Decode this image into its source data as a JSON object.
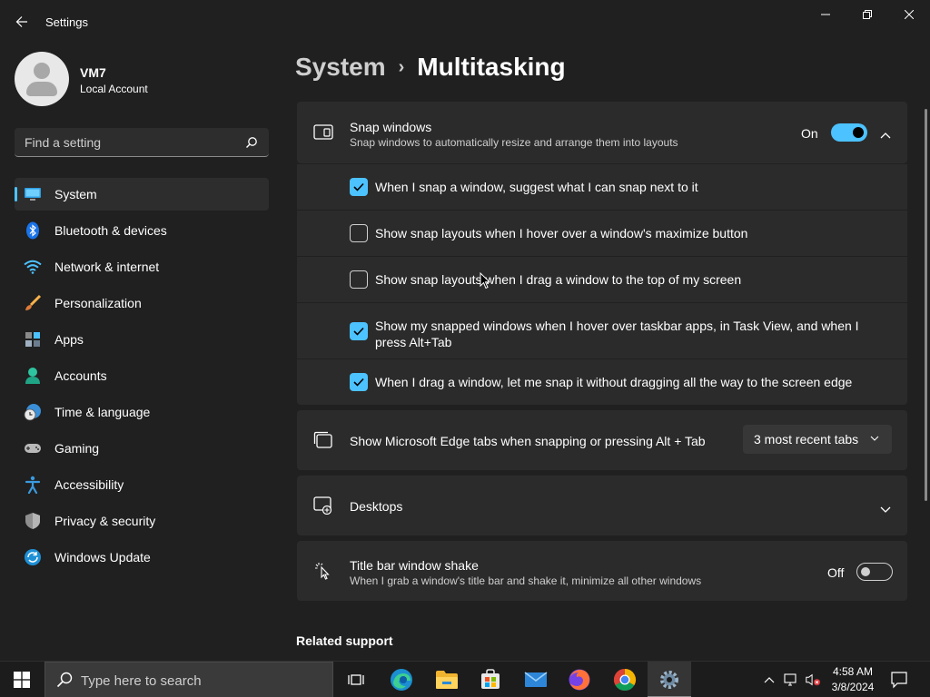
{
  "window": {
    "title": "Settings"
  },
  "profile": {
    "name": "VM7",
    "account_type": "Local Account"
  },
  "search": {
    "placeholder": "Find a setting"
  },
  "sidebar": {
    "items": [
      {
        "label": "System",
        "icon": "monitor-icon",
        "active": true
      },
      {
        "label": "Bluetooth & devices",
        "icon": "bluetooth-icon"
      },
      {
        "label": "Network & internet",
        "icon": "wifi-icon"
      },
      {
        "label": "Personalization",
        "icon": "brush-icon"
      },
      {
        "label": "Apps",
        "icon": "apps-icon"
      },
      {
        "label": "Accounts",
        "icon": "person-icon"
      },
      {
        "label": "Time & language",
        "icon": "globe-clock-icon"
      },
      {
        "label": "Gaming",
        "icon": "gamepad-icon"
      },
      {
        "label": "Accessibility",
        "icon": "accessibility-icon"
      },
      {
        "label": "Privacy & security",
        "icon": "shield-icon"
      },
      {
        "label": "Windows Update",
        "icon": "update-icon"
      }
    ]
  },
  "breadcrumb": {
    "parent": "System",
    "separator": "›",
    "current": "Multitasking"
  },
  "snap": {
    "title": "Snap windows",
    "description": "Snap windows to automatically resize and arrange them into layouts",
    "state_label": "On",
    "enabled": true,
    "options": [
      {
        "label": "When I snap a window, suggest what I can snap next to it",
        "checked": true
      },
      {
        "label": "Show snap layouts when I hover over a window's maximize button",
        "checked": false
      },
      {
        "label": "Show snap layouts when I drag a window to the top of my screen",
        "checked": false
      },
      {
        "label": "Show my snapped windows when I hover over taskbar apps, in Task View, and when I press Alt+Tab",
        "checked": true
      },
      {
        "label": "When I drag a window, let me snap it without dragging all the way to the screen edge",
        "checked": true
      }
    ]
  },
  "edge_tabs": {
    "title": "Show Microsoft Edge tabs when snapping or pressing Alt + Tab",
    "selected": "3 most recent tabs"
  },
  "desktops": {
    "title": "Desktops"
  },
  "shake": {
    "title": "Title bar window shake",
    "description": "When I grab a window's title bar and shake it, minimize all other windows",
    "state_label": "Off",
    "enabled": false
  },
  "related": {
    "title": "Related support"
  },
  "taskbar": {
    "search_placeholder": "Type here to search",
    "time": "4:58 AM",
    "date": "3/8/2024"
  },
  "colors": {
    "accent": "#4cc2ff",
    "background": "#202020",
    "card": "#2b2b2b"
  }
}
